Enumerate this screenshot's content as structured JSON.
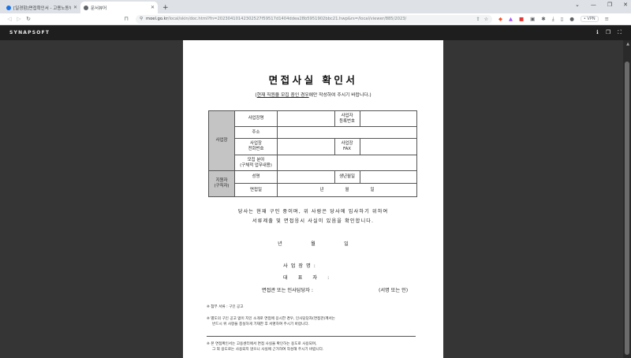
{
  "browser": {
    "tabs": [
      {
        "label": "[일경험]면접확인서 - 고용노동부",
        "active": false
      },
      {
        "label": "문서뷰어",
        "active": true
      }
    ],
    "new_tab": "+",
    "url_host": "moel.go.kr",
    "url_path": "/local/skin/doc.html?fn=20230410142302527f59517d1404ddea28b5951902bbc21.hwp&rs=/local/viewer/885/2023/",
    "vpn_label": "• VPN",
    "window_controls": [
      "⌄",
      "—",
      "❐",
      "✕"
    ]
  },
  "viewer": {
    "brand": "SYNAPSOFT",
    "icons": [
      "info-icon",
      "copy-icon",
      "fullscreen-icon"
    ]
  },
  "document": {
    "title": "면접사실 확인서",
    "note_prefix": "(",
    "note_underlined": "현재 직원을 모집 중인 경우",
    "note_suffix": "에만 작성하여 주시기 바랍니다.)",
    "table": {
      "employer_group": "사업장",
      "applicant_group_line1": "지원자",
      "applicant_group_line2": "(구직자)",
      "company_name": "사업장명",
      "biz_reg_no_line1": "사업자",
      "biz_reg_no_line2": "등록번호",
      "address": "주소",
      "phone_line1": "사업장",
      "phone_line2": "전화번호",
      "fax_line1": "사업장",
      "fax_line2": "FAX",
      "field_line1": "모집 분야",
      "field_line2": "(구체적 업무내용)",
      "name": "성명",
      "birthdate": "생년월일",
      "interview_date": "면접일",
      "date_y": "년",
      "date_m": "월",
      "date_d": "일"
    },
    "statement_line1": "당사는 현재 구인 중이며, 위 사람은 당사에 입사하기 위하여",
    "statement_line2": "서류제출 및 면접응시 사실이 있음을 확인합니다.",
    "date_y": "년",
    "date_m": "월",
    "date_d": "일",
    "sig_company": "사업장명:",
    "sig_rep": "대표자:",
    "sig_officer": "면접관 또는 인사담당자 :",
    "sig_stamp": "(서명 또는 인)",
    "footnote1": "※ 첨부 서류 : 구인 공고",
    "footnote2_line1": "※ 별도의 구인 공고 없이 지인 소개로 면접에 응시한 경우, 인사담당자(면접관)께서는",
    "footnote2_line2": "반드시 위 사항을 충실하게 기재한 후 서명하여 주시기 바랍니다.",
    "footnote3_line1": "※ 본 면접확인서는 고용센터에서 면접 사실을 확인하는 용도로 사용되며,",
    "footnote3_line2": "그 외 용도로는 사용되지 않으니 사실에 근거하여 작성해 주시기 바랍니다."
  }
}
